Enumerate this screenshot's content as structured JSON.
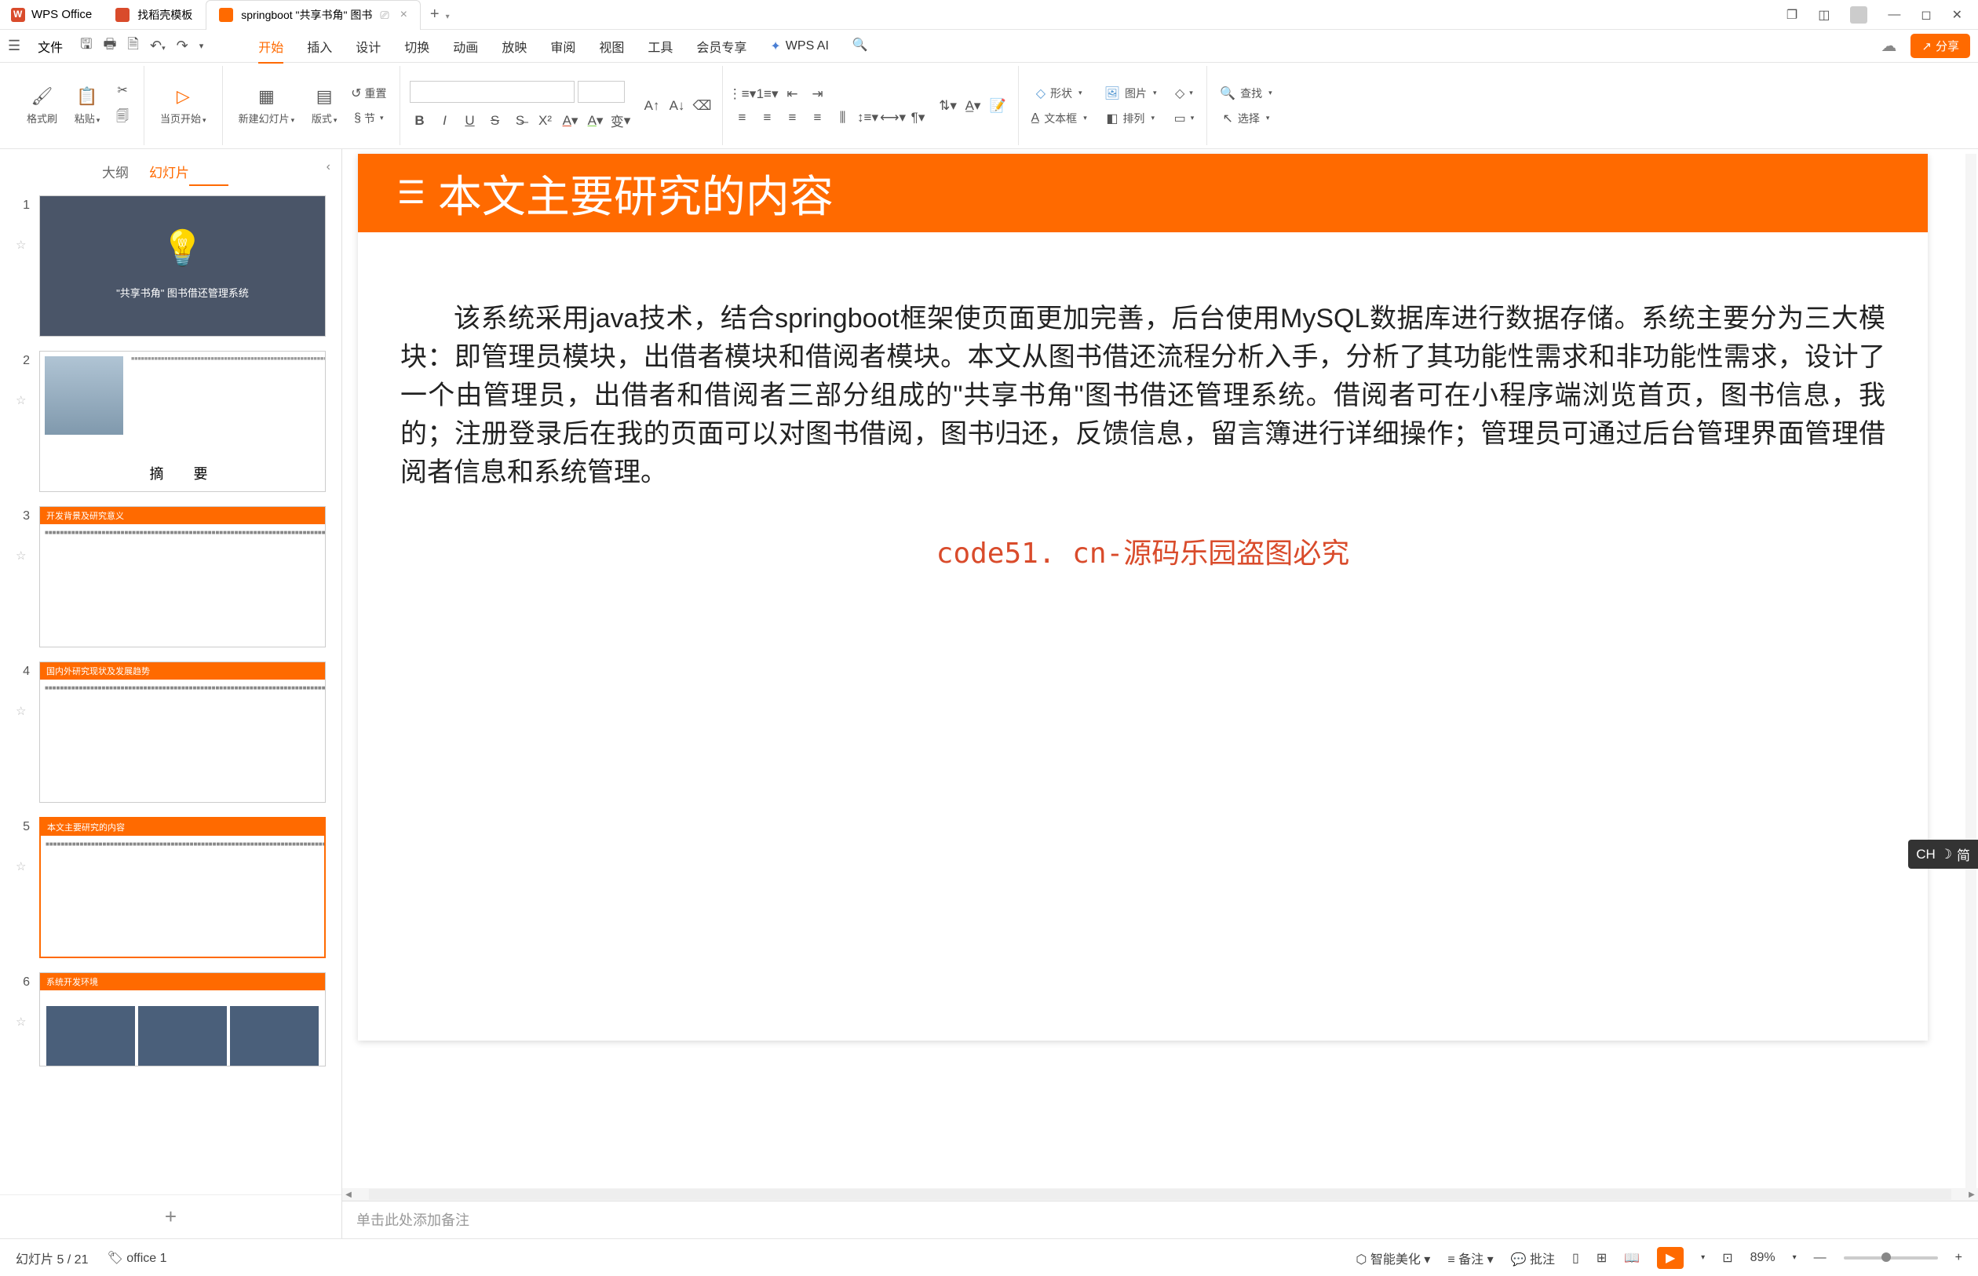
{
  "titlebar": {
    "app_name": "WPS Office",
    "tabs": [
      {
        "label": "找稻壳模板",
        "active": false
      },
      {
        "label": "springboot \"共享书角\" 图书",
        "active": true
      }
    ]
  },
  "menubar": {
    "file": "文件",
    "tabs": [
      "开始",
      "插入",
      "设计",
      "切换",
      "动画",
      "放映",
      "审阅",
      "视图",
      "工具",
      "会员专享"
    ],
    "active_tab": "开始",
    "ai": "WPS AI",
    "share": "分享"
  },
  "ribbon": {
    "format_brush": "格式刷",
    "paste": "粘贴",
    "cur_page": "当页开始",
    "new_slide": "新建幻灯片",
    "layout": "版式",
    "section": "节",
    "reset": "重置",
    "shape": "形状",
    "image": "图片",
    "textbox": "文本框",
    "arrange": "排列",
    "find": "查找",
    "select": "选择"
  },
  "slidepanel": {
    "tabs": {
      "outline": "大纲",
      "slides": "幻灯片"
    },
    "slides": [
      {
        "num": "1",
        "title": "\"共享书角\" 图书借还管理系统",
        "dark": true
      },
      {
        "num": "2",
        "caption": "摘　要"
      },
      {
        "num": "3",
        "bar": "开发背景及研究意义"
      },
      {
        "num": "4",
        "bar": "国内外研究现状及发展趋势"
      },
      {
        "num": "5",
        "bar": "本文主要研究的内容",
        "selected": true
      },
      {
        "num": "6",
        "bar": "系统开发环境"
      }
    ]
  },
  "slide": {
    "title": "本文主要研究的内容",
    "body": "该系统采用java技术，结合springboot框架使页面更加完善，后台使用MySQL数据库进行数据存储。系统主要分为三大模块：即管理员模块，出借者模块和借阅者模块。本文从图书借还流程分析入手，分析了其功能性需求和非功能性需求，设计了一个由管理员，出借者和借阅者三部分组成的\"共享书角\"图书借还管理系统。借阅者可在小程序端浏览首页，图书信息，我的；注册登录后在我的页面可以对图书借阅，图书归还，反馈信息，留言簿进行详细操作；管理员可通过后台管理界面管理借阅者信息和系统管理。",
    "watermark": "code51. cn-源码乐园盗图必究"
  },
  "notes_placeholder": "单击此处添加备注",
  "statusbar": {
    "slide_info": "幻灯片 5 / 21",
    "office": "office 1",
    "beautify": "智能美化",
    "notes": "备注",
    "comments": "批注",
    "zoom": "89%"
  },
  "ime": {
    "lang": "CH",
    "mode": "简"
  }
}
